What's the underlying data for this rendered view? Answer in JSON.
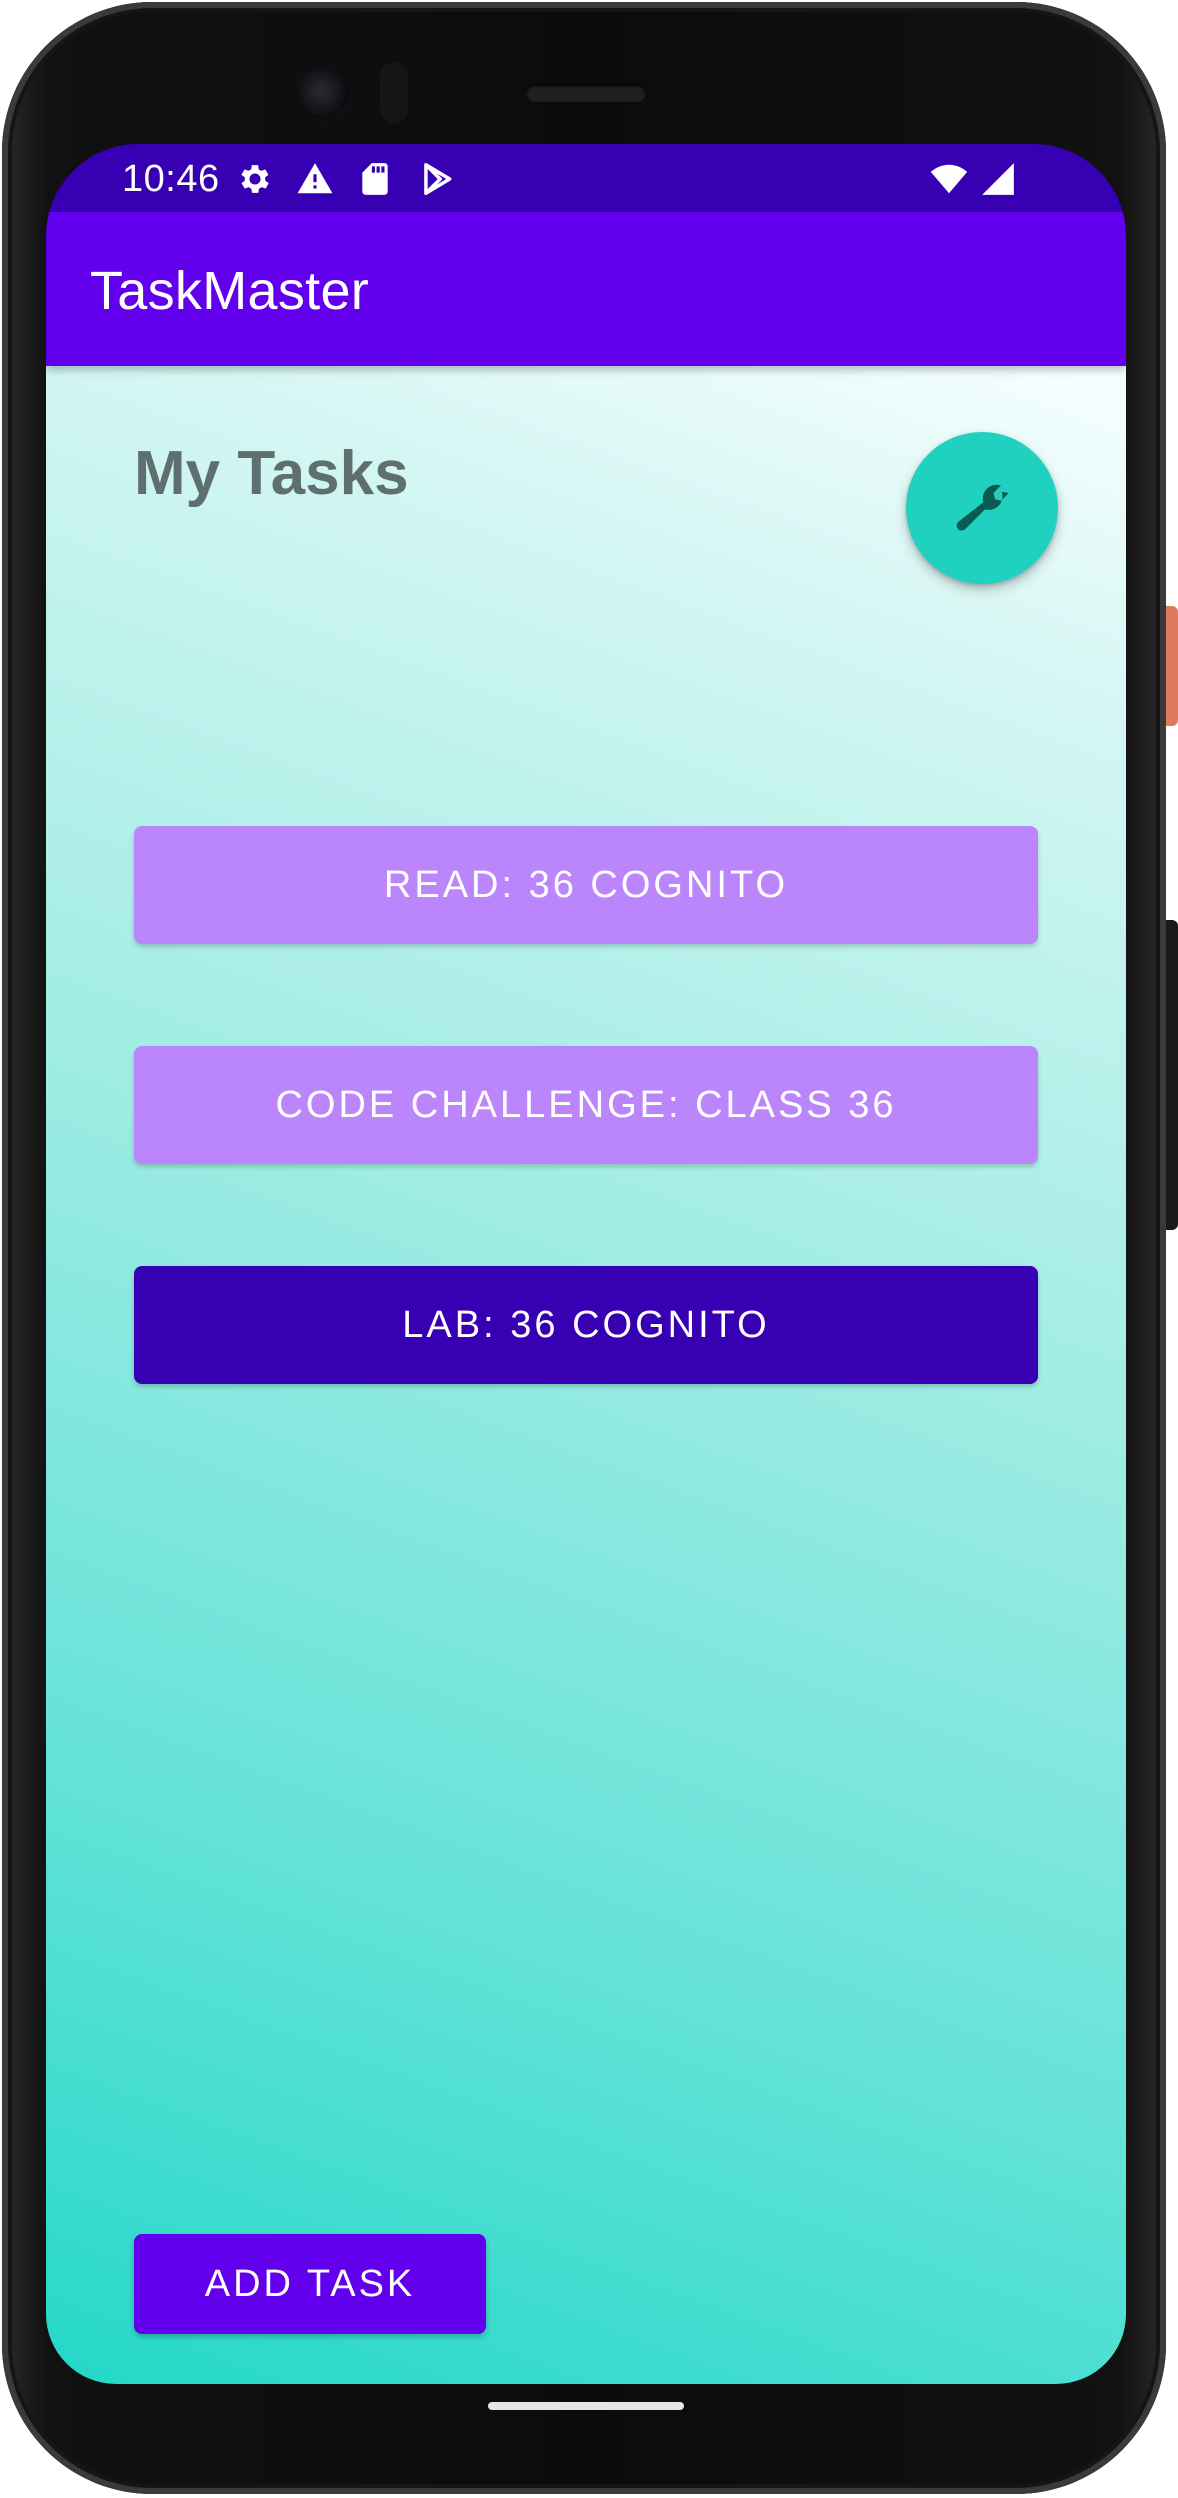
{
  "status_bar": {
    "time": "10:46",
    "left_icons": [
      "gear-icon",
      "warning-icon",
      "sd-card-icon",
      "play-store-icon"
    ],
    "right_icons": [
      "wifi-icon",
      "cell-signal-icon"
    ]
  },
  "app_bar": {
    "title": "TaskMaster"
  },
  "main": {
    "heading": "My Tasks",
    "settings_fab_icon": "wrench-icon",
    "tasks": [
      {
        "label": "READ: 36 COGNITO"
      },
      {
        "label": "CODE CHALLENGE: CLASS 36"
      },
      {
        "label": "LAB: 36 COGNITO"
      }
    ],
    "add_task_label": "ADD TASK"
  },
  "colors": {
    "status_bar": "#3700b3",
    "app_bar": "#6200ee",
    "task_light": "#bb86fc",
    "task_dark": "#3700b3",
    "fab": "#1fd1be",
    "add_button": "#6200ee"
  }
}
